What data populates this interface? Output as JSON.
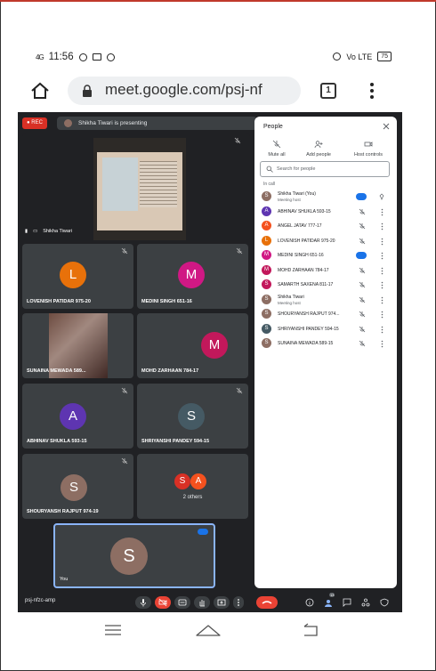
{
  "status_bar": {
    "time": "11:56",
    "signal": "4G",
    "battery": "75",
    "network": "Vo LTE"
  },
  "browser": {
    "url": "meet.google.com/psj-nf",
    "tab_count": "1"
  },
  "meeting": {
    "rec_label": "REC",
    "presenting_text": "Shikha Tiwari is presenting",
    "presenter_label": "Shikha Tiwari",
    "code": "psj-nfzc-amp",
    "tiles": [
      {
        "name": "LOVENISH PATIDAR 975-20",
        "initial": "L",
        "color": "#e8710a"
      },
      {
        "name": "MEDINI SINGH 651-16",
        "initial": "M",
        "color": "#d01884"
      },
      {
        "name": "SUNAINA MEWADA 589...",
        "initial": "",
        "color": ""
      },
      {
        "name": "MOHD ZARHAAN 784-17",
        "initial": "M",
        "color": "#c2185b"
      },
      {
        "name": "ABHINAV SHUKLA 593-15",
        "initial": "A",
        "color": "#5e35b1"
      },
      {
        "name": "SHRIYANSHI PANDEY 594-15",
        "initial": "S",
        "color": "#455a64"
      },
      {
        "name": "SHOURYANSH RAJPUT 974-19",
        "initial": "S",
        "color": "#8d6e63"
      },
      {
        "name": "2 others",
        "initial": "S",
        "color": "#d93025",
        "initial2": "A",
        "color2": "#f4511e"
      }
    ],
    "self": {
      "label": "You",
      "initial": "S",
      "color": "#8d6e63"
    }
  },
  "people_panel": {
    "title": "People",
    "actions": {
      "mute_all": "Mute all",
      "add_people": "Add people",
      "host_controls": "Host controls"
    },
    "search_placeholder": "Search for people",
    "in_call_label": "In call",
    "participants": [
      {
        "initial": "S",
        "name": "Shikha Tiwari (You)",
        "role": "Meeting host",
        "color": "#8d6e63"
      },
      {
        "initial": "A",
        "name": "ABHINAV SHUKLA 593-15",
        "role": "",
        "color": "#5e35b1"
      },
      {
        "initial": "A",
        "name": "ANGEL JATAV 777-17",
        "role": "",
        "color": "#f4511e"
      },
      {
        "initial": "L",
        "name": "LOVENISH PATIDAR 975-20",
        "role": "",
        "color": "#e8710a"
      },
      {
        "initial": "M",
        "name": "MEDINI SINGH 651-16",
        "role": "",
        "color": "#d01884"
      },
      {
        "initial": "M",
        "name": "MOHD ZARHAAN 784-17",
        "role": "",
        "color": "#c2185b"
      },
      {
        "initial": "S",
        "name": "SAMARTH SAXENA 811-17",
        "role": "",
        "color": "#c2185b"
      },
      {
        "initial": "S",
        "name": "Shikha Tiwari",
        "role": "Meeting host",
        "color": "#8d6e63"
      },
      {
        "initial": "S",
        "name": "SHOURYANSH RAJPUT 974...",
        "role": "",
        "color": "#8d6e63"
      },
      {
        "initial": "S",
        "name": "SHRIYANSHI PANDEY 594-15",
        "role": "",
        "color": "#455a64"
      },
      {
        "initial": "S",
        "name": "SUNAINA MEWADA 589-15",
        "role": "",
        "color": "#8d6e63"
      }
    ],
    "badge_count": "13"
  }
}
